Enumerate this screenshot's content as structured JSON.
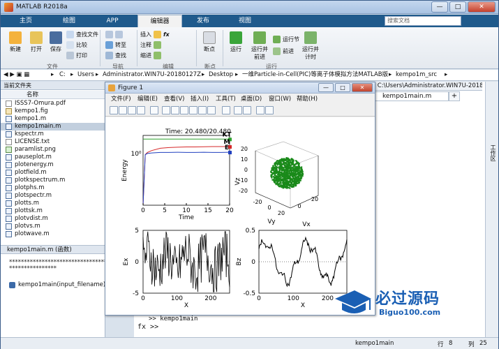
{
  "window": {
    "title": "MATLAB R2018a",
    "minimize": "—",
    "maximize": "□",
    "close": "✕"
  },
  "ribbon_tabs": [
    "主页",
    "绘图",
    "APP",
    "编辑器",
    "发布",
    "视图"
  ],
  "search_placeholder": "搜索文档",
  "ribbon": {
    "new": "新建",
    "open": "打开",
    "save": "保存",
    "find_files": "查找文件",
    "compare": "比较",
    "print": "打印",
    "insert": "插入",
    "comment": "注释",
    "indent": "缩进",
    "goto": "转至",
    "find": "查找",
    "breakpoint": "断点",
    "run": "运行",
    "run_advance": "运行并\n前进",
    "run_section": "运行节",
    "advance": "前进",
    "run_time": "运行并\n计时",
    "groups": {
      "file": "文件",
      "nav": "导航",
      "edit": "编辑",
      "bp": "断点",
      "run": "运行"
    },
    "fx": "fx"
  },
  "address": [
    "C:",
    "Users",
    "Administrator.WIN7U-20180127Z",
    "Desktop",
    "一维Particle-in-Cell(PIC)等离子体模拟方法MATLAB版",
    "kempo1m_src"
  ],
  "current_folder": {
    "header": "当前文件夹",
    "col_name": "名称",
    "files": [
      {
        "name": "ISSS7-Omura.pdf",
        "type": "txt"
      },
      {
        "name": "kempo1.fig",
        "type": "fig"
      },
      {
        "name": "kempo1.m",
        "type": "m"
      },
      {
        "name": "kempo1main.m",
        "type": "m",
        "selected": true
      },
      {
        "name": "kspectr.m",
        "type": "m"
      },
      {
        "name": "LICENSE.txt",
        "type": "txt"
      },
      {
        "name": "paramlist.png",
        "type": "png"
      },
      {
        "name": "pauseplot.m",
        "type": "m"
      },
      {
        "name": "plotenergy.m",
        "type": "m"
      },
      {
        "name": "plotfield.m",
        "type": "m"
      },
      {
        "name": "plotkspectrum.m",
        "type": "m"
      },
      {
        "name": "plotphs.m",
        "type": "m"
      },
      {
        "name": "plotspectr.m",
        "type": "m"
      },
      {
        "name": "plotts.m",
        "type": "m"
      },
      {
        "name": "plottsk.m",
        "type": "m"
      },
      {
        "name": "plotvdist.m",
        "type": "m"
      },
      {
        "name": "plotvs.m",
        "type": "m"
      },
      {
        "name": "plotwave.m",
        "type": "m"
      }
    ]
  },
  "details": {
    "title": "kempo1main.m (函数)",
    "stars1": "**********************************",
    "stars2": "****************",
    "func": "kempo1main(input_filename)"
  },
  "editor": {
    "crumb": "- C:\\Users\\Administrator.WIN7U-20180127Z\\Desktop\\一维Particle-in-Cell(PIC)等离子体模拟方法MATLAB版\\k...",
    "tab": "kempo1main.m",
    "plus": "+",
    "side_label": "工作区"
  },
  "command": {
    "line1": ">> kempo1main",
    "prompt": "fx >>"
  },
  "status": {
    "name": "kempo1main",
    "row_label": "行",
    "row": "8",
    "col_label": "列",
    "col": "25"
  },
  "figure": {
    "title": "Figure 1",
    "menu": [
      "文件(F)",
      "编辑(E)",
      "查看(V)",
      "插入(I)",
      "工具(T)",
      "桌面(D)",
      "窗口(W)",
      "帮助(H)"
    ]
  },
  "watermark": {
    "text": "必过源码",
    "url": "Biguo100.com"
  },
  "chart_data": [
    {
      "type": "line",
      "title": "Time: 20.480/20.480",
      "xlabel": "Time",
      "ylabel": "Energy",
      "xlim": [
        0,
        20
      ],
      "yscale": "log",
      "xticks": [
        0,
        5,
        10,
        15,
        20
      ],
      "yticks_label": [
        "10⁰"
      ],
      "series": [
        {
          "name": "KT",
          "color": "#2ca02c",
          "x": [
            0,
            2,
            5,
            10,
            15,
            20
          ],
          "y": [
            3.6,
            3.6,
            3.6,
            3.6,
            3.6,
            3.6
          ]
        },
        {
          "name": "M",
          "color": "#d62728",
          "x": [
            0,
            0.5,
            1,
            2,
            4,
            6,
            8,
            10,
            12,
            14,
            16,
            18,
            20
          ],
          "y": [
            0.01,
            0.9,
            1.1,
            1.3,
            1.6,
            1.7,
            1.75,
            1.8,
            1.8,
            1.82,
            1.85,
            1.85,
            1.85
          ]
        },
        {
          "name": "E",
          "color": "#1f3fbf",
          "x": [
            0,
            0.5,
            1,
            2,
            4,
            6,
            8,
            10,
            12,
            14,
            16,
            18,
            20
          ],
          "y": [
            0.01,
            0.9,
            1.0,
            1.05,
            1.1,
            1.1,
            1.12,
            1.1,
            1.1,
            1.12,
            1.1,
            1.1,
            1.12
          ]
        }
      ]
    },
    {
      "type": "scatter",
      "title": "",
      "xlabel": "Vx",
      "ylabel": "Vy",
      "zlabel": "Vz",
      "xticks": [
        0,
        20
      ],
      "yticks": [
        -20,
        0,
        20
      ],
      "zticks": [
        -20,
        -10,
        0,
        10,
        20
      ],
      "color": "#1a8a1a"
    },
    {
      "type": "line",
      "title": "",
      "xlabel": "X",
      "ylabel": "Ex",
      "xlim": [
        0,
        256
      ],
      "ylim": [
        -5,
        5
      ],
      "xticks": [
        0,
        100,
        200
      ],
      "yticks": [
        -5,
        0,
        5
      ]
    },
    {
      "type": "line",
      "title": "",
      "xlabel": "X",
      "ylabel": "Bz",
      "xlim": [
        0,
        256
      ],
      "ylim": [
        -0.5,
        0.5
      ],
      "xticks": [
        0,
        100,
        200
      ],
      "yticks": [
        -0.5,
        0,
        0.5
      ]
    }
  ]
}
